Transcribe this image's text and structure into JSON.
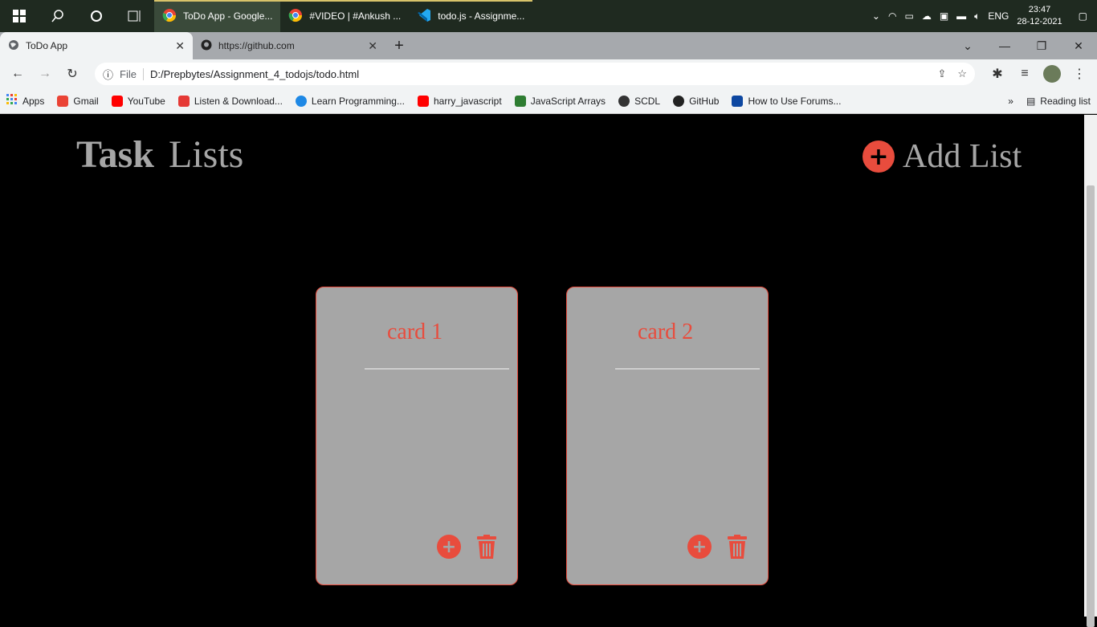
{
  "taskbar": {
    "apps": [
      {
        "label": "ToDo App - Google..."
      },
      {
        "label": "#VIDEO | #Ankush ..."
      },
      {
        "label": "todo.js - Assignme..."
      }
    ],
    "lang": "ENG",
    "time": "23:47",
    "date": "28-12-2021"
  },
  "browser": {
    "tabs": [
      {
        "label": "ToDo App"
      },
      {
        "label": "https://github.com"
      }
    ],
    "address_scheme": "File",
    "address": "D:/Prepbytes/Assignment_4_todojs/todo.html",
    "bookmarks": [
      {
        "label": "Apps",
        "color": "#4285f4"
      },
      {
        "label": "Gmail",
        "color": "#ea4335"
      },
      {
        "label": "YouTube",
        "color": "#ff0000"
      },
      {
        "label": "Listen & Download...",
        "color": "#e53935"
      },
      {
        "label": "Learn Programming...",
        "color": "#1e88e5"
      },
      {
        "label": "harry_javascript",
        "color": "#ff0000"
      },
      {
        "label": "JavaScript Arrays",
        "color": "#2e7d32"
      },
      {
        "label": "SCDL",
        "color": "#333333"
      },
      {
        "label": "GitHub",
        "color": "#222222"
      },
      {
        "label": "How to Use Forums...",
        "color": "#0d47a1"
      }
    ],
    "reading_list": "Reading list"
  },
  "page": {
    "title_bold": "Task",
    "title_rest": "Lists",
    "add_list_label": "Add List",
    "accent": "#e84c3d",
    "cards": [
      {
        "title": "card 1"
      },
      {
        "title": "card 2"
      }
    ]
  }
}
